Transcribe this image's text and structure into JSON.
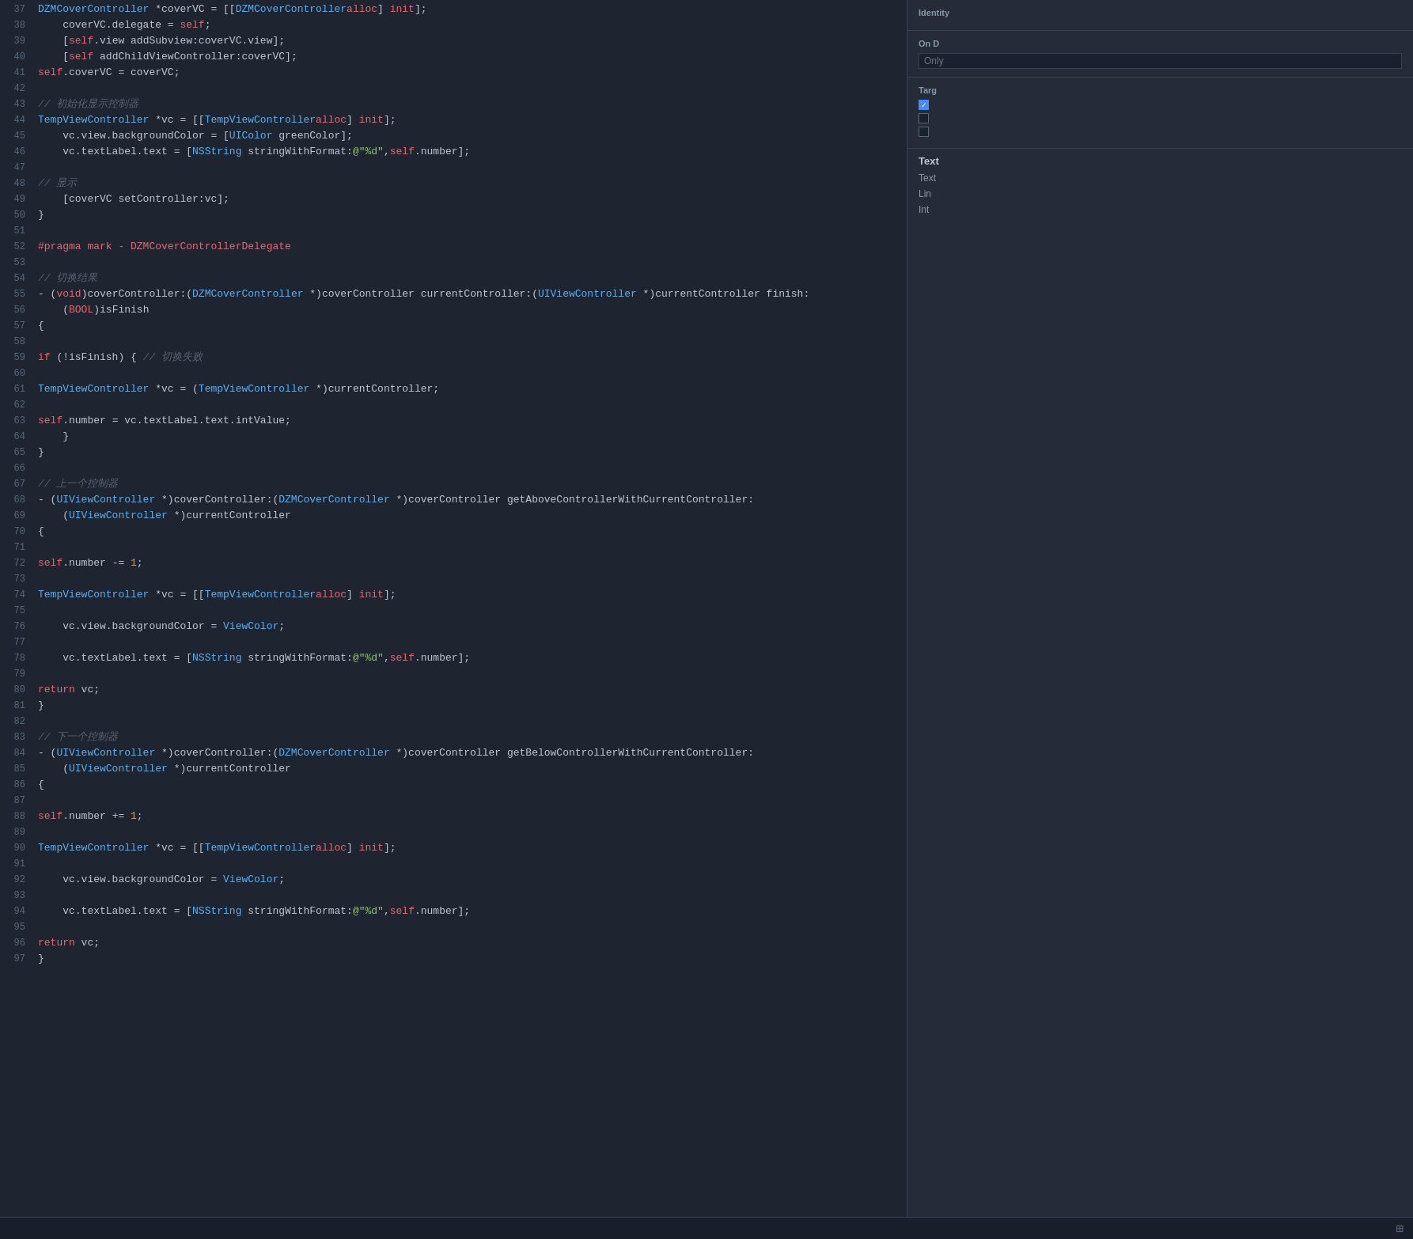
{
  "editor": {
    "lines": [
      {
        "num": "37",
        "content": [
          {
            "t": "    DZMCoverController *coverVC = [[",
            "c": "plain"
          },
          {
            "t": "DZMCoverController",
            "c": "cls"
          },
          {
            "t": " alloc] init];",
            "c": "plain"
          }
        ]
      },
      {
        "num": "38",
        "content": [
          {
            "t": "    coverVC.delegate = self;",
            "c": "plain"
          }
        ]
      },
      {
        "num": "39",
        "content": [
          {
            "t": "    [self.view addSubview:coverVC.view];",
            "c": "plain"
          }
        ]
      },
      {
        "num": "40",
        "content": [
          {
            "t": "    [self addChildViewController:coverVC];",
            "c": "plain"
          }
        ]
      },
      {
        "num": "41",
        "content": [
          {
            "t": "    self.coverVC = coverVC;",
            "c": "plain"
          }
        ]
      },
      {
        "num": "42",
        "content": []
      },
      {
        "num": "43",
        "content": [
          {
            "t": "    // 初始化显示控制器",
            "c": "comment"
          }
        ]
      },
      {
        "num": "44",
        "content": [
          {
            "t": "    TempViewController *vc = [[",
            "c": "plain"
          },
          {
            "t": "TempViewController",
            "c": "cls"
          },
          {
            "t": " alloc] init];",
            "c": "plain"
          }
        ]
      },
      {
        "num": "45",
        "content": [
          {
            "t": "    vc.view.backgroundColor = [UIColor greenColor];",
            "c": "plain"
          }
        ]
      },
      {
        "num": "46",
        "content": [
          {
            "t": "    vc.textLabel.text = [NSString stringWithFormat:@\"%d\",self.number];",
            "c": "plain"
          }
        ]
      },
      {
        "num": "47",
        "content": []
      },
      {
        "num": "48",
        "content": [
          {
            "t": "    // 显示",
            "c": "comment"
          }
        ]
      },
      {
        "num": "49",
        "content": [
          {
            "t": "    [coverVC setController:vc];",
            "c": "plain"
          }
        ]
      },
      {
        "num": "50",
        "content": [
          {
            "t": "}",
            "c": "plain"
          }
        ]
      },
      {
        "num": "51",
        "content": []
      },
      {
        "num": "52",
        "content": [
          {
            "t": "#pragma mark - DZMCoverControllerDelegate",
            "c": "pragma"
          }
        ]
      },
      {
        "num": "53",
        "content": []
      },
      {
        "num": "54",
        "content": [
          {
            "t": "// 切换结果",
            "c": "comment"
          }
        ]
      },
      {
        "num": "55",
        "content": [
          {
            "t": "- (void)coverController:(DZMCoverController *)coverController currentController:(UIViewController *)currentController finish:",
            "c": "plain"
          }
        ]
      },
      {
        "num": "56",
        "content": [
          {
            "t": "    (BOOL)isFinish",
            "c": "plain"
          }
        ]
      },
      {
        "num": "57",
        "content": [
          {
            "t": "{",
            "c": "plain"
          }
        ]
      },
      {
        "num": "58",
        "content": []
      },
      {
        "num": "59",
        "content": [
          {
            "t": "    if (!isFinish) { // 切换失败",
            "c": "plain"
          }
        ]
      },
      {
        "num": "60",
        "content": []
      },
      {
        "num": "61",
        "content": [
          {
            "t": "        TempViewController *vc = (TempViewController *)currentController;",
            "c": "plain"
          }
        ]
      },
      {
        "num": "62",
        "content": []
      },
      {
        "num": "63",
        "content": [
          {
            "t": "        self.number = vc.textLabel.text.intValue;",
            "c": "plain"
          }
        ]
      },
      {
        "num": "64",
        "content": [
          {
            "t": "    }",
            "c": "plain"
          }
        ]
      },
      {
        "num": "65",
        "content": [
          {
            "t": "}",
            "c": "plain"
          }
        ]
      },
      {
        "num": "66",
        "content": []
      },
      {
        "num": "67",
        "content": [
          {
            "t": "// 上一个控制器",
            "c": "comment"
          }
        ]
      },
      {
        "num": "68",
        "content": [
          {
            "t": "- (UIViewController *)coverController:(DZMCoverController *)coverController getAboveControllerWithCurrentController:",
            "c": "plain"
          }
        ]
      },
      {
        "num": "69",
        "content": [
          {
            "t": "    (UIViewController *)currentController",
            "c": "plain"
          }
        ]
      },
      {
        "num": "70",
        "content": [
          {
            "t": "{",
            "c": "plain"
          }
        ]
      },
      {
        "num": "71",
        "content": []
      },
      {
        "num": "72",
        "content": [
          {
            "t": "    self.number -= 1;",
            "c": "plain"
          }
        ]
      },
      {
        "num": "73",
        "content": []
      },
      {
        "num": "74",
        "content": [
          {
            "t": "    TempViewController *vc = [[TempViewController alloc] init];",
            "c": "plain"
          }
        ]
      },
      {
        "num": "75",
        "content": []
      },
      {
        "num": "76",
        "content": [
          {
            "t": "    vc.view.backgroundColor = ViewColor;",
            "c": "plain"
          }
        ]
      },
      {
        "num": "77",
        "content": []
      },
      {
        "num": "78",
        "content": [
          {
            "t": "    vc.textLabel.text = [NSString stringWithFormat:@\"%d\",self.number];",
            "c": "plain"
          }
        ]
      },
      {
        "num": "79",
        "content": []
      },
      {
        "num": "80",
        "content": [
          {
            "t": "    return vc;",
            "c": "plain"
          }
        ]
      },
      {
        "num": "81",
        "content": [
          {
            "t": "}",
            "c": "plain"
          }
        ]
      },
      {
        "num": "82",
        "content": []
      },
      {
        "num": "83",
        "content": [
          {
            "t": "// 下一个控制器",
            "c": "comment"
          }
        ]
      },
      {
        "num": "84",
        "content": [
          {
            "t": "- (UIViewController *)coverController:(DZMCoverController *)coverController getBelowControllerWithCurrentController:",
            "c": "plain"
          }
        ]
      },
      {
        "num": "85",
        "content": [
          {
            "t": "    (UIViewController *)currentController",
            "c": "plain"
          }
        ]
      },
      {
        "num": "86",
        "content": [
          {
            "t": "{",
            "c": "plain"
          }
        ]
      },
      {
        "num": "87",
        "content": []
      },
      {
        "num": "88",
        "content": [
          {
            "t": "    self.number += 1;",
            "c": "plain"
          }
        ]
      },
      {
        "num": "89",
        "content": []
      },
      {
        "num": "90",
        "content": [
          {
            "t": "    TempViewController *vc = [[TempViewController alloc] init];",
            "c": "plain"
          }
        ]
      },
      {
        "num": "91",
        "content": []
      },
      {
        "num": "92",
        "content": [
          {
            "t": "    vc.view.backgroundColor = ViewColor;",
            "c": "plain"
          }
        ]
      },
      {
        "num": "93",
        "content": []
      },
      {
        "num": "94",
        "content": [
          {
            "t": "    vc.textLabel.text = [NSString stringWithFormat:@\"%d\",self.number];",
            "c": "plain"
          }
        ]
      },
      {
        "num": "95",
        "content": []
      },
      {
        "num": "96",
        "content": [
          {
            "t": "    return vc;",
            "c": "plain"
          }
        ]
      },
      {
        "num": "97",
        "content": [
          {
            "t": "}",
            "c": "plain"
          }
        ]
      }
    ]
  },
  "right_panel": {
    "identity_section": {
      "title": "Identity",
      "label": ""
    },
    "on_demand_section": {
      "title": "On D",
      "input_placeholder": "Only"
    },
    "targets_section": {
      "title": "Targ",
      "items": [
        {
          "checked": true,
          "label": ""
        },
        {
          "checked": false,
          "label": ""
        },
        {
          "checked": false,
          "label": ""
        }
      ]
    },
    "text_section": {
      "title": "Text",
      "items": [
        {
          "label": "Text"
        },
        {
          "label": "Lin"
        },
        {
          "label": "Int"
        }
      ]
    }
  },
  "bottom_bar": {
    "grid_icon": "⊞"
  }
}
